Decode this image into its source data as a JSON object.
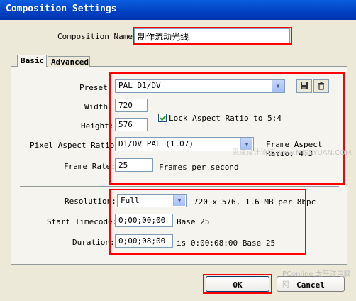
{
  "window": {
    "title": "Composition Settings"
  },
  "composition_name": {
    "label": "Composition Name:",
    "value": "制作流动光线"
  },
  "tabs": [
    {
      "label": "Basic"
    },
    {
      "label": "Advanced"
    }
  ],
  "basic": {
    "preset": {
      "label": "Preset:",
      "value": "PAL D1/DV"
    },
    "width": {
      "label": "Width:",
      "value": "720"
    },
    "height": {
      "label": "Height:",
      "value": "576"
    },
    "lock_aspect": {
      "label": "Lock Aspect Ratio to 5:4",
      "checked": true
    },
    "pixel_aspect": {
      "label": "Pixel Aspect Ratio:",
      "value": "D1/DV PAL (1.07)"
    },
    "frame_aspect": {
      "line1": "Frame Aspect",
      "line2": "Ratio: 4:3"
    },
    "frame_rate": {
      "label": "Frame Rate:",
      "value": "25",
      "unit": "Frames per second"
    },
    "resolution": {
      "label": "Resolution:",
      "value": "Full",
      "info": "720 x 576, 1.6 MB per 8bpc"
    },
    "start_timecode": {
      "label": "Start Timecode:",
      "value": "0;00;00;00",
      "base": "Base 25"
    },
    "duration": {
      "label": "Duration:",
      "value": "0;00;08;00",
      "info": "is 0:00:08:00  Base 25"
    }
  },
  "buttons": {
    "ok": "OK",
    "cancel": "Cancel"
  },
  "icons": [
    "save-preset-icon",
    "delete-preset-icon",
    "dropdown-arrow-icon",
    "checkbox-checked-icon"
  ],
  "watermarks": {
    "top": "思缘设计论坛 www.MISSYUAN.COM",
    "bottom": "PConline 太平洋电脑网"
  }
}
